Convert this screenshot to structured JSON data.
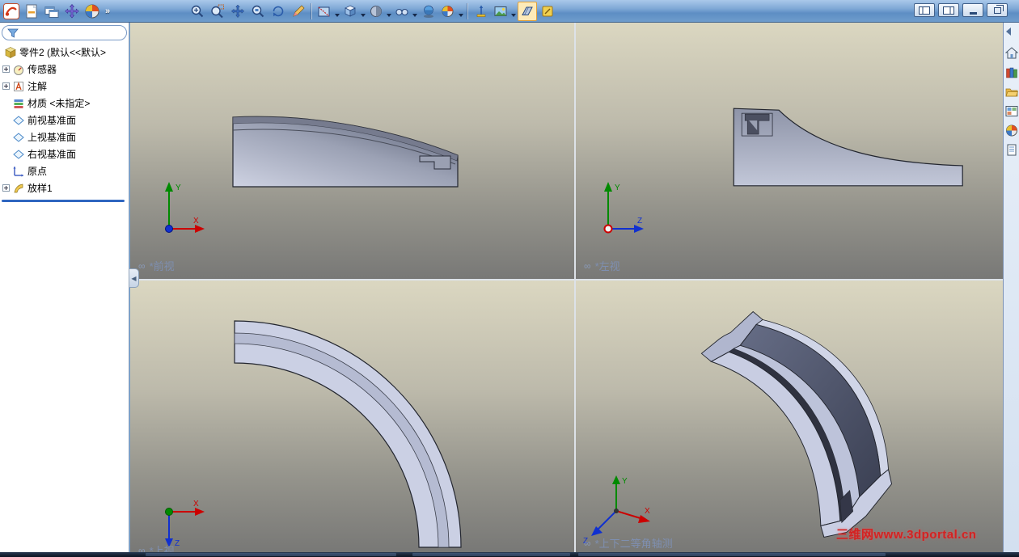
{
  "titlebar": {
    "left_icons": [
      "solidworks-logo",
      "new-document-icon",
      "window-cascade-icon",
      "move-tool-icon",
      "help-orb-icon"
    ],
    "overflow_chevron": "»",
    "window_buttons": [
      "viewport-layout-left",
      "viewport-layout-right",
      "minimize",
      "restore"
    ]
  },
  "view_toolbar": {
    "buttons": [
      "zoom-in",
      "zoom-area",
      "pan",
      "zoom-selection",
      "rotate-view",
      "sketch-pencil",
      "section-view",
      "view-orientation",
      "display-style",
      "hide-show-items",
      "shadows",
      "appearances",
      "reference-axis",
      "camera-image",
      "draft-quality",
      "rapid-sketch"
    ],
    "active_button": "draft-quality"
  },
  "sidebar": {
    "filter": {
      "value": ""
    },
    "tree": [
      {
        "label": "零件2 (默认<<默认>",
        "icon": "part-icon",
        "expand": false
      },
      {
        "label": "传感器",
        "icon": "sensors-icon",
        "expand": true
      },
      {
        "label": "注解",
        "icon": "annotations-icon",
        "expand": true
      },
      {
        "label": "材质 <未指定>",
        "icon": "material-icon",
        "expand": false
      },
      {
        "label": "前视基准面",
        "icon": "plane-icon",
        "expand": false
      },
      {
        "label": "上视基准面",
        "icon": "plane-icon",
        "expand": false
      },
      {
        "label": "右视基准面",
        "icon": "plane-icon",
        "expand": false
      },
      {
        "label": "原点",
        "icon": "origin-icon",
        "expand": false
      },
      {
        "label": "放样1",
        "icon": "loft-icon",
        "expand": true
      }
    ],
    "collapse_tab_icon": "◀"
  },
  "viewports": {
    "front": {
      "label": "*前视"
    },
    "left": {
      "label": "*左视"
    },
    "top": {
      "label": "*上视"
    },
    "iso": {
      "label": "*上下二等角轴测"
    }
  },
  "view_badge": "∞",
  "axis_labels": {
    "x": "X",
    "y": "Y",
    "z": "Z"
  },
  "watermark": {
    "text": "三维网www.3dportal.cn"
  },
  "task_pane_icons": [
    "home",
    "design-library",
    "file-explorer",
    "view-palette",
    "appearances-scenes",
    "custom-properties"
  ],
  "colors": {
    "accent": "#2f66c0",
    "watermark": "#d42222",
    "viewport_label": "#7e8fb0",
    "axis_x": "#cc0000",
    "axis_y": "#008a00",
    "axis_z": "#1030d0"
  }
}
